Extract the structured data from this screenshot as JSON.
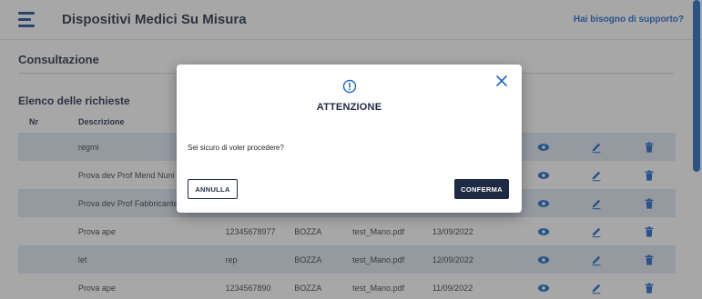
{
  "app": {
    "title": "Dispositivi Medici Su Misura",
    "help_link": "Hai bisogno di supporto?",
    "section_title": "Consultazione",
    "list_title": "Elenco delle richieste",
    "columns": {
      "index": "Nr",
      "name": "Descrizione"
    },
    "rows": [
      {
        "name": "regmi",
        "code": "",
        "version": "",
        "file": "",
        "date": "",
        "alt": true
      },
      {
        "name": "Prova dev Prof Mend Nuni",
        "code": "",
        "version": "",
        "file": "",
        "date": "",
        "alt": false
      },
      {
        "name": "Prova dev Prof Fabbricante Bov",
        "code": "",
        "version": "",
        "file": "",
        "date": "",
        "alt": true
      },
      {
        "name": "Prova ape",
        "code": "12345678977",
        "version": "BOZZA",
        "file": "test_Mano.pdf",
        "date": "13/09/2022",
        "alt": false
      },
      {
        "name": "let",
        "code": "rep",
        "version": "BOZZA",
        "file": "test_Mano.pdf",
        "date": "12/09/2022",
        "alt": true
      },
      {
        "name": "Prova ape",
        "code": "1234567890",
        "version": "BOZZA",
        "file": "test_Mano.pdf",
        "date": "11/09/2022",
        "alt": false
      }
    ],
    "icons": {
      "view": "eye-icon",
      "edit": "pencil-icon",
      "delete": "trash-icon"
    },
    "colors": {
      "accent": "#1a66c9",
      "row_alt": "#dfe8f5",
      "navy": "#1f2a44",
      "icon": "#1a66c9"
    }
  },
  "modal": {
    "title": "ATTENZIONE",
    "message": "Sei sicuro di voler procedere?",
    "cancel_label": "ANNULLA",
    "confirm_label": "CONFERMA",
    "alert_icon": "alert-circle-icon",
    "close_icon": "close-icon"
  }
}
